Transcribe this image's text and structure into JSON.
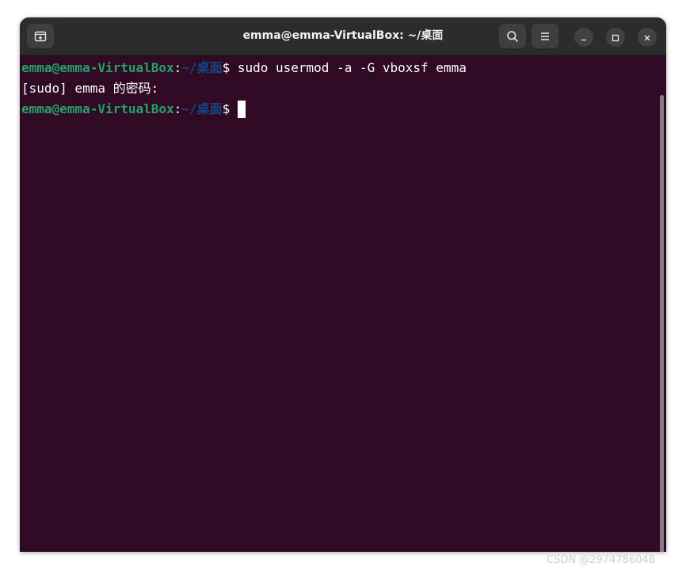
{
  "window": {
    "title": "emma@emma-VirtualBox: ~/桌面"
  },
  "titlebar": {
    "new_tab_icon": "new-tab-icon",
    "search_icon": "search-icon",
    "menu_icon": "hamburger-menu-icon",
    "minimize_icon": "minimize-icon",
    "maximize_icon": "maximize-icon",
    "close_icon": "close-icon"
  },
  "terminal": {
    "lines": [
      {
        "user_host": "emma@emma-VirtualBox",
        "sep": ":",
        "path": "~/桌面",
        "prompt": "$ ",
        "command": "sudo usermod -a -G vboxsf emma"
      },
      {
        "text": "[sudo] emma 的密码:"
      },
      {
        "user_host": "emma@emma-VirtualBox",
        "sep": ":",
        "path": "~/桌面",
        "prompt": "$ ",
        "command": ""
      }
    ]
  },
  "colors": {
    "terminal_bg": "#300a24",
    "user_host": "#26a269",
    "path": "#12488b",
    "titlebar_bg": "#2c2c2c"
  },
  "watermark": "CSDN @2974786048"
}
